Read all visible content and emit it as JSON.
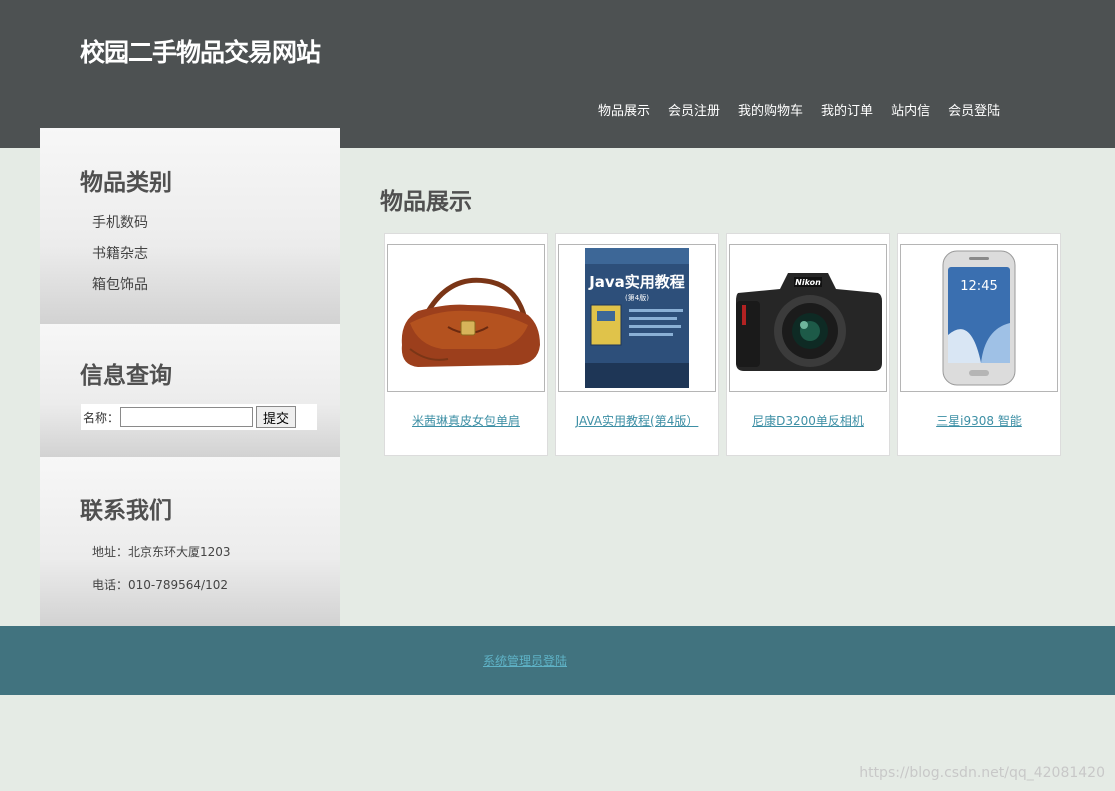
{
  "header": {
    "site_title": "校园二手物品交易网站",
    "nav": [
      "物品展示",
      "会员注册",
      "我的购物车",
      "我的订单",
      "站内信",
      "会员登陆"
    ]
  },
  "sidebar": {
    "categories": {
      "title": "物品类别",
      "items": [
        "手机数码",
        "书籍杂志",
        "箱包饰品"
      ]
    },
    "search": {
      "title": "信息查询",
      "label": "名称：",
      "input_value": "",
      "submit_label": "提交"
    },
    "contact": {
      "title": "联系我们",
      "address": "地址：北京东环大厦1203",
      "phone": "电话：010-789564/102"
    }
  },
  "main": {
    "title": "物品展示",
    "products": [
      {
        "name": "米茜琳真皮女包单肩",
        "image": "handbag-image"
      },
      {
        "name": "JAVA实用教程(第4版）",
        "image": "book-cover-image",
        "cover_title": "Java实用教程",
        "cover_edition": "(第4版)"
      },
      {
        "name": "尼康D3200单反相机",
        "image": "camera-image",
        "brand": "Nikon"
      },
      {
        "name": "三星i9308 智能",
        "image": "smartphone-image",
        "screen_time": "12:45"
      }
    ]
  },
  "footer": {
    "admin_link": "系统管理员登陆"
  },
  "watermark": "https://blog.csdn.net/qq_42081420"
}
